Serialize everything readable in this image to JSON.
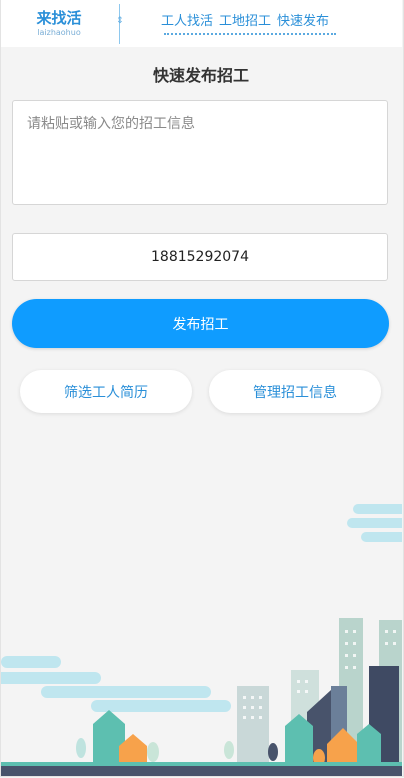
{
  "header": {
    "brand_title": "来找活",
    "brand_sub": "laizhaohuo",
    "nav": [
      "工人找活",
      "工地招工",
      "快速发布"
    ]
  },
  "page_title": "快速发布招工",
  "form": {
    "content_placeholder": "请粘贴或输入您的招工信息",
    "phone_value": "18815292074",
    "publish_label": "发布招工"
  },
  "actions": {
    "filter_label": "筛选工人简历",
    "manage_label": "管理招工信息"
  },
  "colors": {
    "accent": "#0f9cff",
    "brand_text": "#2a8fd8",
    "background": "#f4f4f4"
  }
}
